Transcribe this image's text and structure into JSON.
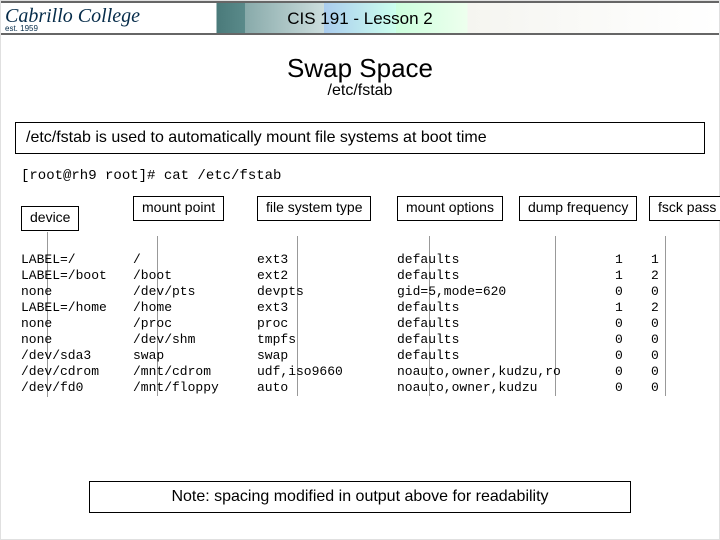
{
  "header": {
    "logo": "Cabrillo College",
    "logo_sub": "est. 1959",
    "course": "CIS 191 - Lesson 2"
  },
  "main": {
    "title": "Swap Space",
    "subtitle": "/etc/fstab",
    "explanation": "/etc/fstab is used to automatically mount file systems at boot time",
    "command": "[root@rh9 root]# cat /etc/fstab"
  },
  "columns": {
    "device": "device",
    "mount_point": "mount\npoint",
    "fs_type": "file system\ntype",
    "mount_options": "mount\noptions",
    "dump_freq": "dump\nfrequency",
    "fsck_pass": "fsck\npass"
  },
  "rows": [
    {
      "device": "LABEL=/",
      "mount": "/",
      "fstype": "ext3",
      "options": "defaults",
      "dump": "1",
      "pass": "1"
    },
    {
      "device": "LABEL=/boot",
      "mount": "/boot",
      "fstype": "ext2",
      "options": "defaults",
      "dump": "1",
      "pass": "2"
    },
    {
      "device": "none",
      "mount": "/dev/pts",
      "fstype": "devpts",
      "options": "gid=5,mode=620",
      "dump": "0",
      "pass": "0"
    },
    {
      "device": "LABEL=/home",
      "mount": "/home",
      "fstype": "ext3",
      "options": "defaults",
      "dump": "1",
      "pass": "2"
    },
    {
      "device": "none",
      "mount": "/proc",
      "fstype": "proc",
      "options": "defaults",
      "dump": "0",
      "pass": "0"
    },
    {
      "device": "none",
      "mount": "/dev/shm",
      "fstype": "tmpfs",
      "options": "defaults",
      "dump": "0",
      "pass": "0"
    },
    {
      "device": "/dev/sda3",
      "mount": "swap",
      "fstype": "swap",
      "options": "defaults",
      "dump": "0",
      "pass": "0"
    },
    {
      "device": "/dev/cdrom",
      "mount": "/mnt/cdrom",
      "fstype": "udf,iso9660",
      "options": "noauto,owner,kudzu,ro",
      "dump": "0",
      "pass": "0"
    },
    {
      "device": "/dev/fd0",
      "mount": "/mnt/floppy",
      "fstype": "auto",
      "options": "noauto,owner,kudzu",
      "dump": "0",
      "pass": "0"
    }
  ],
  "note": "Note: spacing modified in output above for readability"
}
